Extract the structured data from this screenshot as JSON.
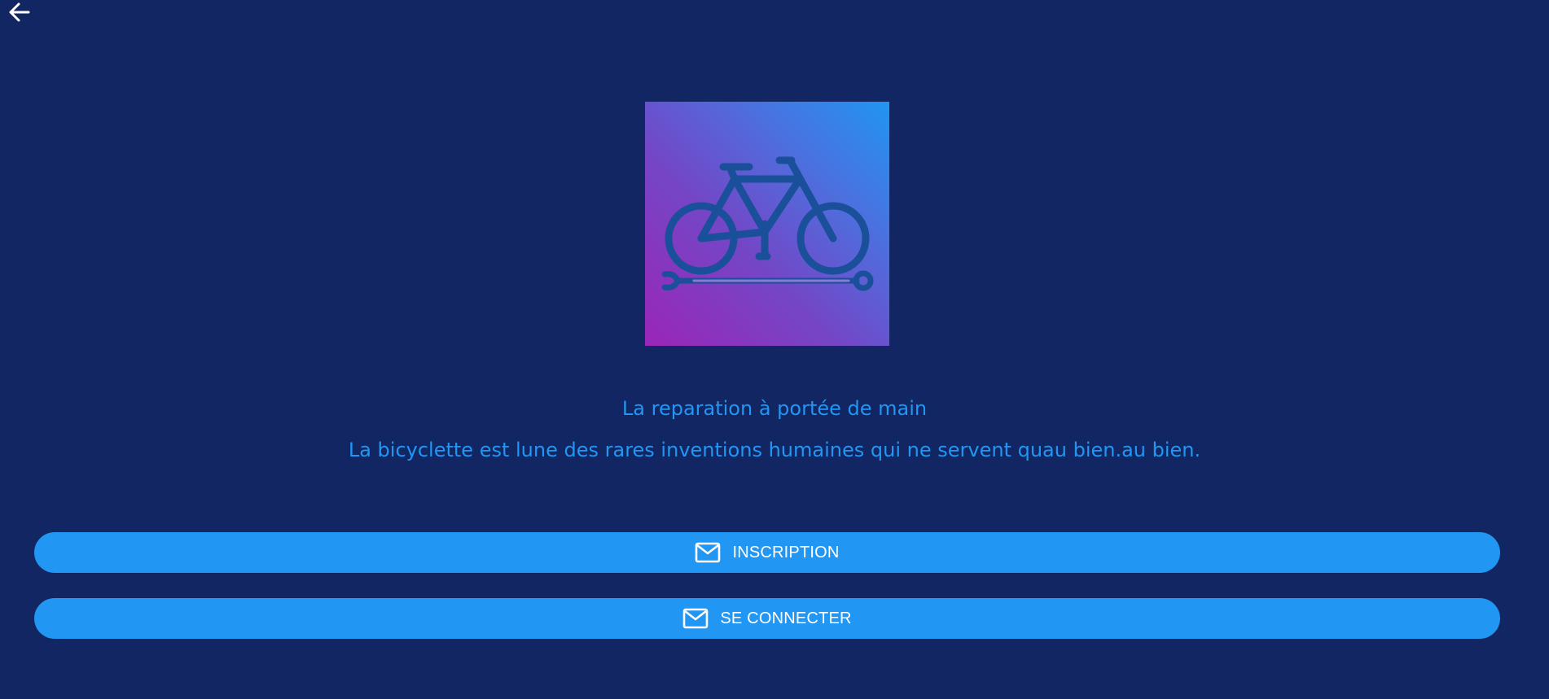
{
  "header": {
    "back_icon": "arrow-left-icon"
  },
  "logo": {
    "icon": "bicycle-repair-icon",
    "gradient_colors": [
      "#9a26b8",
      "#2195f2"
    ],
    "icon_color": "#1a4f99"
  },
  "content": {
    "headline": "La reparation à portée de main",
    "subtitle": "La bicyclette est  lune des rares inventions humaines qui ne servent quau bien.au bien."
  },
  "actions": {
    "signup_label": "INSCRIPTION",
    "signup_icon": "mail-icon",
    "login_label": "SE CONNECTER",
    "login_icon": "mail-icon"
  },
  "colors": {
    "background": "#112662",
    "accent": "#2196f3",
    "button_text": "#ffffff"
  }
}
